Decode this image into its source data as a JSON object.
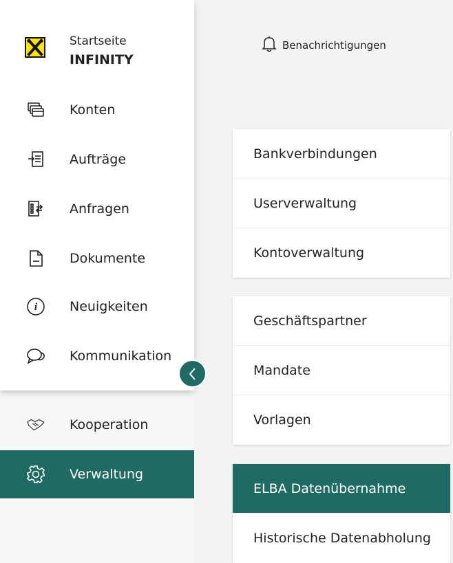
{
  "sidebar": {
    "home": {
      "line1": "Startseite",
      "line2": "INFINITY"
    },
    "items": [
      {
        "label": "Konten",
        "icon": "accounts-icon"
      },
      {
        "label": "Aufträge",
        "icon": "orders-icon"
      },
      {
        "label": "Anfragen",
        "icon": "requests-icon"
      },
      {
        "label": "Dokumente",
        "icon": "document-icon"
      },
      {
        "label": "Neuigkeiten",
        "icon": "info-icon"
      },
      {
        "label": "Kommunikation",
        "icon": "chat-icon"
      }
    ],
    "lower_items": [
      {
        "label": "Kooperation",
        "icon": "handshake-icon"
      },
      {
        "label": "Verwaltung",
        "icon": "gear-icon",
        "active": true
      }
    ]
  },
  "header": {
    "notifications_label": "Benachrichtigungen"
  },
  "menu_groups": [
    {
      "items": [
        "Bankverbindungen",
        "Userverwaltung",
        "Kontoverwaltung"
      ]
    },
    {
      "items": [
        "Geschäftspartner",
        "Mandate",
        "Vorlagen"
      ]
    },
    {
      "items": [
        "ELBA Datenübernahme",
        "Historische Datenabholung"
      ],
      "active": "ELBA Datenübernahme"
    }
  ],
  "colors": {
    "accent": "#1f6b63",
    "logo_yellow": "#ffe600"
  }
}
